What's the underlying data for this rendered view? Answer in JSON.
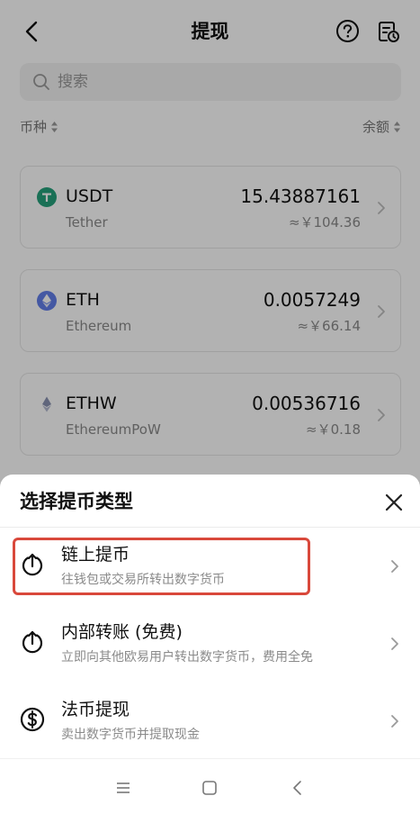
{
  "header": {
    "title": "提现",
    "back_icon": "chevron-left-icon",
    "help_icon": "question-circle-icon",
    "records_icon": "records-clock-icon"
  },
  "search": {
    "placeholder": "搜索"
  },
  "sort": {
    "left_label": "币种",
    "right_label": "余额"
  },
  "assets": [
    {
      "symbol": "USDT",
      "name": "Tether",
      "balance": "15.43887161",
      "fiat": "≈￥104.36",
      "icon_color": "#26a17b"
    },
    {
      "symbol": "ETH",
      "name": "Ethereum",
      "balance": "0.0057249",
      "fiat": "≈￥66.14",
      "icon_color": "#627eea"
    },
    {
      "symbol": "ETHW",
      "name": "EthereumPoW",
      "balance": "0.00536716",
      "fiat": "≈￥0.18",
      "icon_color": "#8a93b2"
    }
  ],
  "sheet": {
    "title": "选择提币类型",
    "close_icon": "close-icon",
    "options": [
      {
        "title": "链上提币",
        "desc": "往钱包或交易所转出数字货币",
        "icon": "upload-circle-icon"
      },
      {
        "title": "内部转账 (免费)",
        "desc": "立即向其他欧易用户转出数字货币，费用全免",
        "icon": "upload-circle-icon"
      },
      {
        "title": "法币提现",
        "desc": "卖出数字货币并提取现金",
        "icon": "dollar-circle-icon"
      }
    ]
  },
  "colors": {
    "highlight": "#d9483b",
    "text_primary": "#111111",
    "text_secondary": "#8a8a8a"
  }
}
